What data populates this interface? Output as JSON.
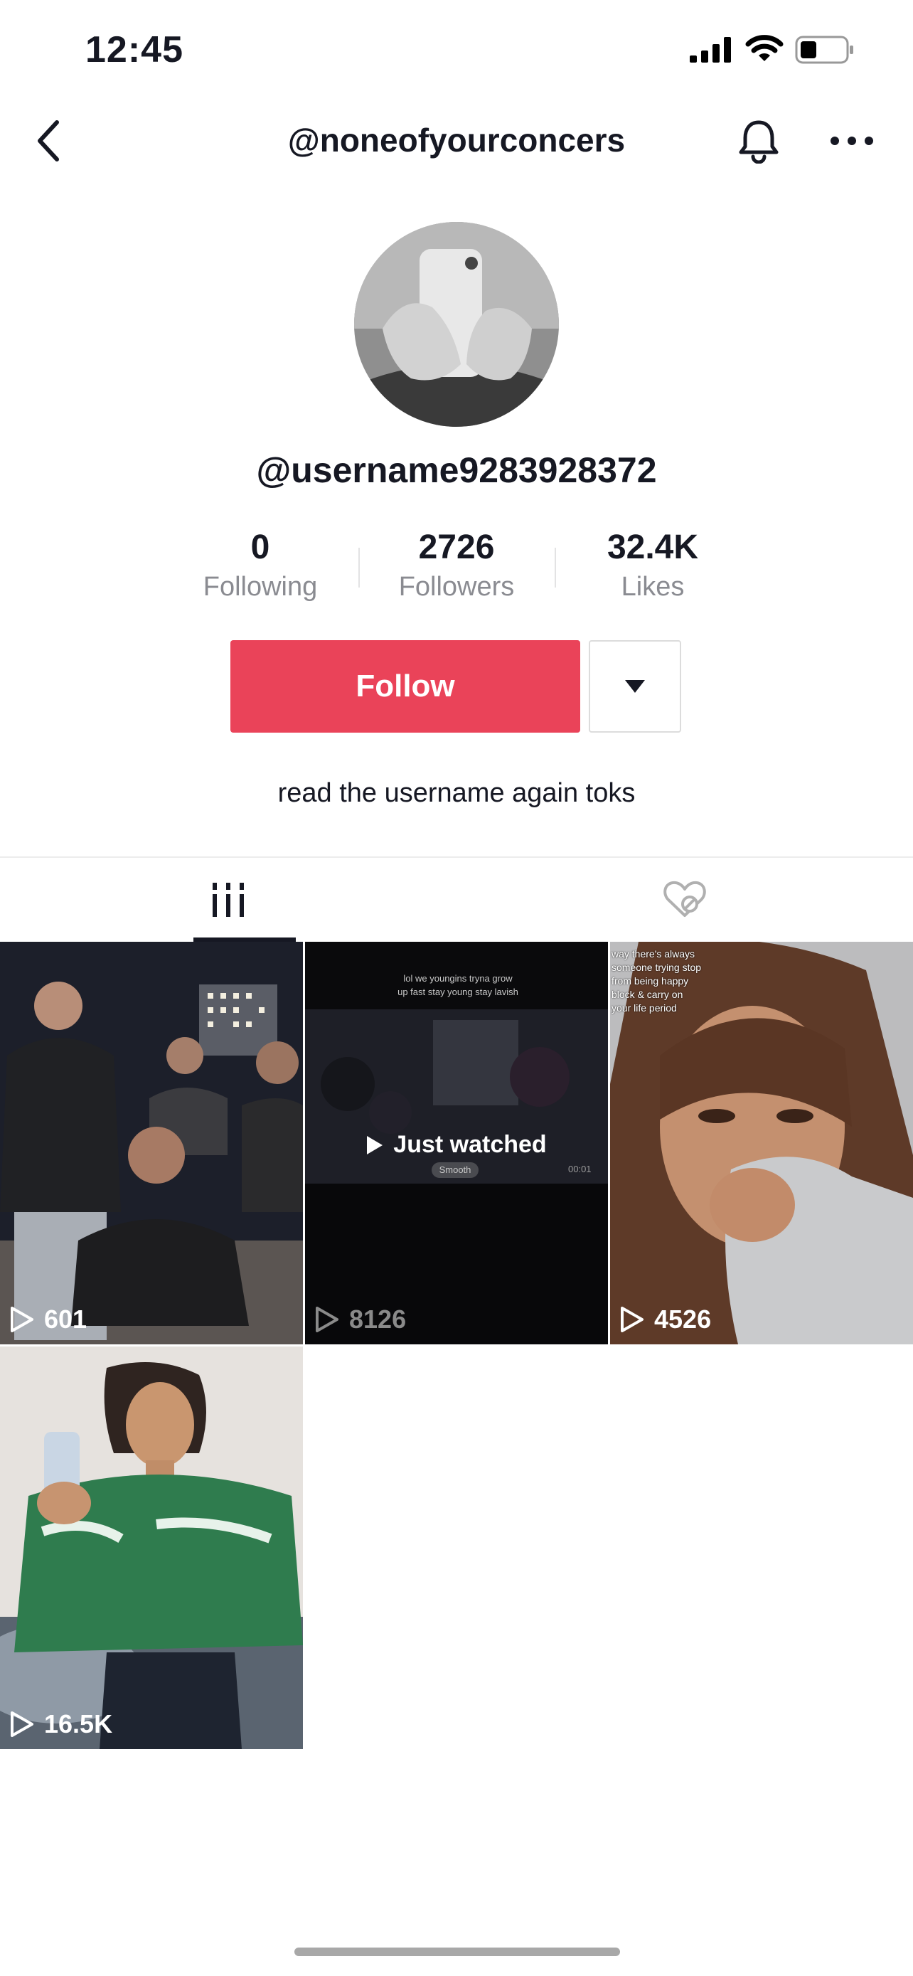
{
  "status_bar": {
    "time": "12:45"
  },
  "nav": {
    "title": "@noneofyourconcers"
  },
  "profile": {
    "username": "@username9283928372",
    "stats": [
      {
        "value": "0",
        "label": "Following"
      },
      {
        "value": "2726",
        "label": "Followers"
      },
      {
        "value": "32.4K",
        "label": "Likes"
      }
    ],
    "follow_label": "Follow",
    "bio": "read the username again toks"
  },
  "videos": [
    {
      "views": "601"
    },
    {
      "views": "8126",
      "overlay": "Just watched",
      "caption": "lol we youngins tryna grow up fast stay young stay lavish",
      "tag": "Smooth",
      "duration": "00:01"
    },
    {
      "views": "4526",
      "caption": "way there's always someone trying stop from being happy block & carry on your life period"
    },
    {
      "views": "16.5K"
    }
  ],
  "colors": {
    "accent": "#ea4359",
    "text": "#161823",
    "muted": "#8a8b91"
  }
}
